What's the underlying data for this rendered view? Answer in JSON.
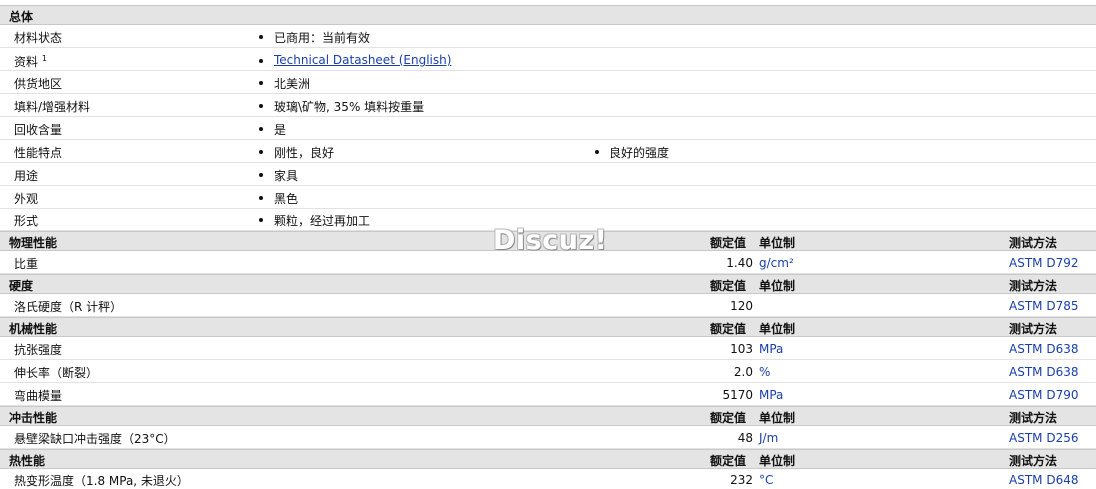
{
  "general": {
    "title": "总体",
    "rows": [
      {
        "label": "材料状态",
        "values": [
          "已商用：当前有效"
        ]
      },
      {
        "label": "资料",
        "sup": "1",
        "values": [
          "Technical Datasheet (English)"
        ],
        "link": true
      },
      {
        "label": "供货地区",
        "values": [
          "北美洲"
        ]
      },
      {
        "label": "填料/增强材料",
        "values": [
          "玻璃\\矿物, 35% 填料按重量"
        ]
      },
      {
        "label": "回收含量",
        "values": [
          "是"
        ]
      },
      {
        "label": "性能特点",
        "values": [
          "刚性，良好",
          "良好的强度"
        ]
      },
      {
        "label": "用途",
        "values": [
          "家具"
        ]
      },
      {
        "label": "外观",
        "values": [
          "黑色"
        ]
      },
      {
        "label": "形式",
        "values": [
          "颗粒，经过再加工"
        ]
      }
    ]
  },
  "header_labels": {
    "rated": "额定值",
    "unit": "单位制",
    "method": "测试方法"
  },
  "sections": [
    {
      "title": "物理性能",
      "rows": [
        {
          "label": "比重",
          "value": "1.40",
          "unit": "g/cm²",
          "method": "ASTM D792"
        }
      ]
    },
    {
      "title": "硬度",
      "rows": [
        {
          "label": "洛氏硬度（R 计秤）",
          "value": "120",
          "unit": "",
          "method": "ASTM D785"
        }
      ]
    },
    {
      "title": "机械性能",
      "rows": [
        {
          "label": "抗张强度",
          "value": "103",
          "unit": "MPa",
          "method": "ASTM D638"
        },
        {
          "label": "伸长率（断裂）",
          "value": "2.0",
          "unit": "%",
          "method": "ASTM D638"
        },
        {
          "label": "弯曲模量",
          "value": "5170",
          "unit": "MPa",
          "method": "ASTM D790"
        }
      ]
    },
    {
      "title": "冲击性能",
      "rows": [
        {
          "label": "悬壁梁缺口冲击强度（23°C）",
          "value": "48",
          "unit": "J/m",
          "method": "ASTM D256"
        }
      ]
    },
    {
      "title": "热性能",
      "rows": [
        {
          "label": "热变形温度（1.8 MPa, 未退火）",
          "value": "232",
          "unit": "°C",
          "method": "ASTM D648"
        }
      ]
    }
  ],
  "watermark": "Discuz!"
}
